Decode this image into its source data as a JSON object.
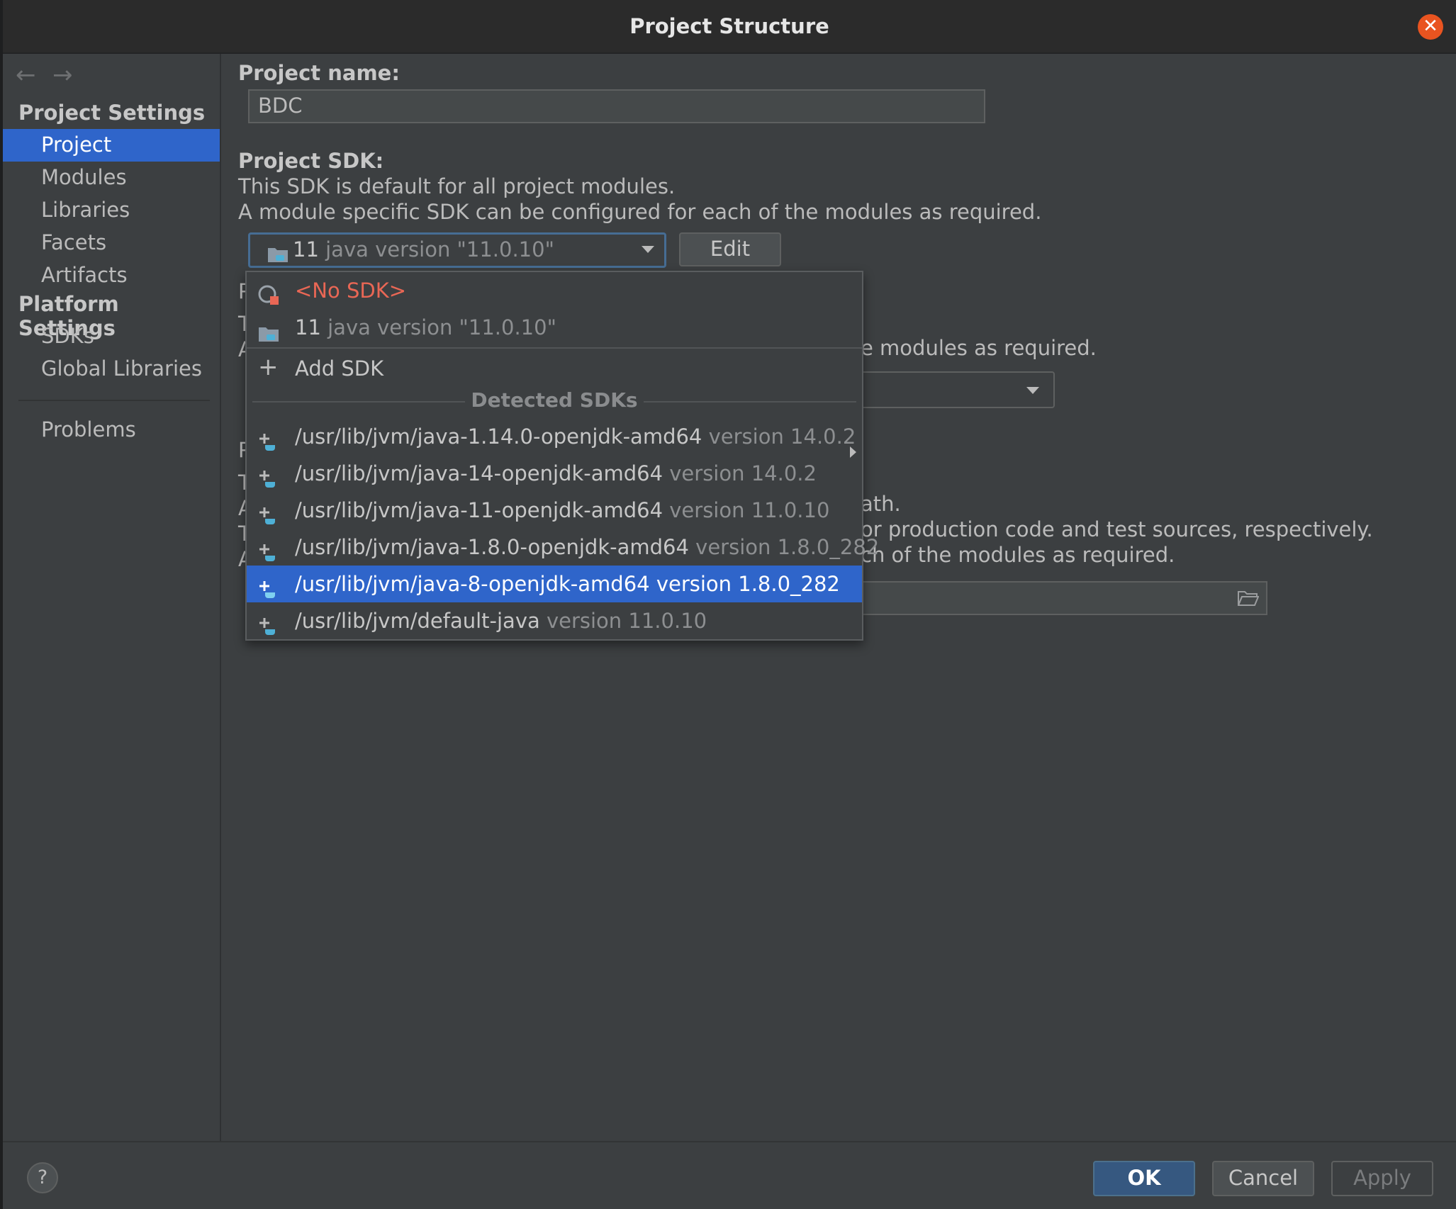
{
  "window": {
    "title": "Project Structure"
  },
  "sidebar": {
    "project_settings_header": "Project Settings",
    "project_items": [
      "Project",
      "Modules",
      "Libraries",
      "Facets",
      "Artifacts"
    ],
    "platform_settings_header": "Platform Settings",
    "platform_items": [
      "SDKs",
      "Global Libraries"
    ],
    "problems": "Problems",
    "selected": "Project"
  },
  "main": {
    "project_name_label": "Project name:",
    "project_name_value": "BDC",
    "project_sdk_label": "Project SDK:",
    "sdk_desc_line1": "This SDK is default for all project modules.",
    "sdk_desc_line2": "A module specific SDK can be configured for each of the modules as required.",
    "sdk_combo_num": "11",
    "sdk_combo_version": "java version \"11.0.10\"",
    "edit_button": "Edit",
    "hidden_lang_text": "e modules as required.",
    "hidden_path_line1": "ath.",
    "hidden_path_line2": "or production code and test sources, respectively.",
    "hidden_path_line3": "ch of the modules as required.",
    "hidden_peek_letters": [
      "P",
      "T",
      "A",
      "P",
      "T",
      "A",
      "T",
      "A"
    ]
  },
  "sdk_popup": {
    "no_sdk": "<No SDK>",
    "current_num": "11",
    "current_version": "java version \"11.0.10\"",
    "add_sdk": "Add SDK",
    "detected_header": "Detected SDKs",
    "detected": [
      {
        "path": "/usr/lib/jvm/java-1.14.0-openjdk-amd64",
        "version": "version 14.0.2"
      },
      {
        "path": "/usr/lib/jvm/java-14-openjdk-amd64",
        "version": "version 14.0.2"
      },
      {
        "path": "/usr/lib/jvm/java-11-openjdk-amd64",
        "version": "version 11.0.10"
      },
      {
        "path": "/usr/lib/jvm/java-1.8.0-openjdk-amd64",
        "version": "version 1.8.0_282"
      },
      {
        "path": "/usr/lib/jvm/java-8-openjdk-amd64",
        "version": "version 1.8.0_282"
      },
      {
        "path": "/usr/lib/jvm/default-java",
        "version": "version 11.0.10"
      }
    ],
    "selected_index": 4
  },
  "footer": {
    "help": "?",
    "ok": "OK",
    "cancel": "Cancel",
    "apply": "Apply"
  },
  "colors": {
    "selection": "#2f65ca",
    "no_sdk_red": "#e96755",
    "close_orange": "#e95420",
    "ok_blue": "#365880"
  }
}
